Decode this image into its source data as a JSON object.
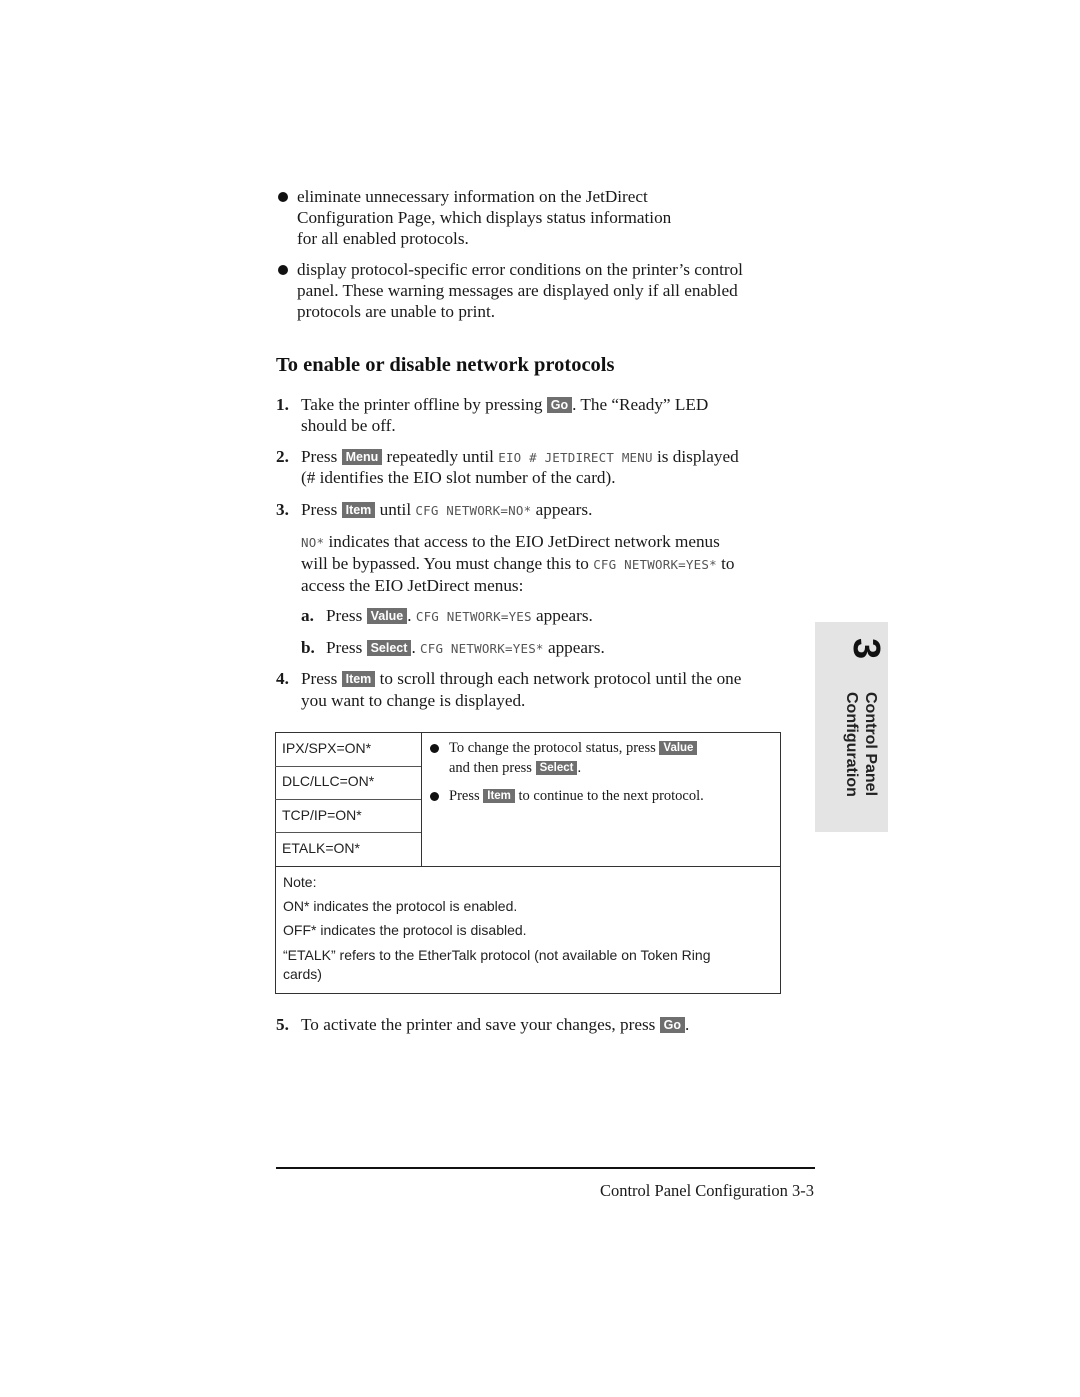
{
  "intro_bullets": [
    {
      "lines": [
        "eliminate unnecessary information on the JetDirect",
        "Configuration Page, which displays status information",
        "for all enabled protocols."
      ]
    },
    {
      "lines": [
        "display protocol-specific error conditions on the printer’s control",
        "panel. These warning messages are displayed only if all enabled",
        "protocols are unable to print."
      ]
    }
  ],
  "heading": "To enable or disable network protocols",
  "steps": {
    "s1": {
      "num": "1.",
      "pre": "Take the printer offline by pressing ",
      "key": "Go",
      "post": ". The “Ready” LED",
      "line2": "should be off."
    },
    "s2": {
      "num": "2.",
      "pre": "Press ",
      "key": "Menu",
      "mid": " repeatedly until ",
      "code": "EIO # JETDIRECT MENU",
      "post": " is displayed",
      "line2": "(# identifies the EIO slot number of the card)."
    },
    "s3": {
      "num": "3.",
      "pre": "Press ",
      "key": "Item",
      "mid": " until ",
      "code": "CFG NETWORK=NO*",
      "post": " appears."
    },
    "s3_note": {
      "code1": "NO*",
      "text1": " indicates that access to the EIO JetDirect network menus",
      "text2": "will be bypassed. You must change this to ",
      "code2": "CFG NETWORK=YES*",
      "text2b": " to",
      "text3": "access the EIO JetDirect menus:"
    },
    "s3a": {
      "num": "a.",
      "pre": "Press ",
      "key": "Value",
      "mid": ". ",
      "code": "CFG NETWORK=YES",
      "post": " appears."
    },
    "s3b": {
      "num": "b.",
      "pre": "Press ",
      "key": "Select",
      "mid": ". ",
      "code": "CFG NETWORK=YES*",
      "post": " appears."
    },
    "s4": {
      "num": "4.",
      "pre": "Press ",
      "key": "Item",
      "post": " to scroll through each network protocol until the one",
      "line2": "you want to change is displayed."
    },
    "s5": {
      "num": "5.",
      "pre": "To activate the printer and save your changes, press ",
      "key": "Go",
      "post": "."
    }
  },
  "table": {
    "protocols": [
      "IPX/SPX=ON*",
      "DLC/LLC=ON*",
      "TCP/IP=ON*",
      "ETALK=ON*"
    ],
    "instr1": {
      "pre": "To change the protocol status, press ",
      "key": "Value",
      "line2": "and then press ",
      "key2": "Select",
      "post2": "."
    },
    "instr2": {
      "pre": "Press ",
      "key": "Item",
      "post": " to continue to the next protocol."
    },
    "note": [
      "Note:",
      "ON* indicates the protocol is enabled.",
      "OFF* indicates the protocol is disabled.",
      "“ETALK” refers to the EtherTalk protocol (not available on Token Ring",
      "cards)"
    ]
  },
  "side_tab": {
    "number": "3",
    "line1": "Control Panel",
    "line2": "Configuration"
  },
  "footer": {
    "text": "Control Panel Configuration 3-3"
  }
}
